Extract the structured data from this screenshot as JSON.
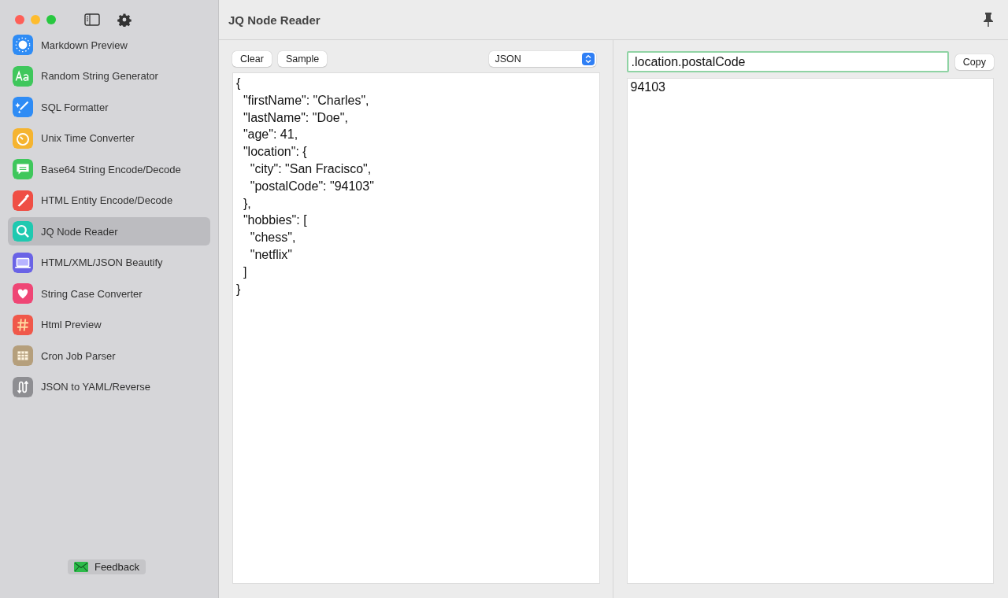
{
  "sidebar": {
    "items": [
      {
        "label": "Markdown Preview",
        "color": "#2f8cf5",
        "selected": false
      },
      {
        "label": "Random String Generator",
        "color": "#3fc75c",
        "selected": false
      },
      {
        "label": "SQL Formatter",
        "color": "#2f8cf5",
        "selected": false
      },
      {
        "label": "Unix Time Converter",
        "color": "#f5b430",
        "selected": false
      },
      {
        "label": "Base64 String Encode/Decode",
        "color": "#3fc75c",
        "selected": false
      },
      {
        "label": "HTML Entity Encode/Decode",
        "color": "#ef4f45",
        "selected": false
      },
      {
        "label": "JQ Node Reader",
        "color": "#1fc9b0",
        "selected": true
      },
      {
        "label": "HTML/XML/JSON Beautify",
        "color": "#6a63e6",
        "selected": false
      },
      {
        "label": "String Case Converter",
        "color": "#ef4675",
        "selected": false
      },
      {
        "label": "Html Preview",
        "color": "#f0584a",
        "selected": false
      },
      {
        "label": "Cron Job Parser",
        "color": "#b59f7c",
        "selected": false
      },
      {
        "label": "JSON to YAML/Reverse",
        "color": "#8e8e92",
        "selected": false
      }
    ],
    "feedback": "Feedback"
  },
  "window": {
    "title": "JQ Node Reader"
  },
  "input_pane": {
    "buttons": [
      "Clear",
      "Sample"
    ],
    "format": "JSON",
    "lines": [
      "{",
      "  \"firstName\": \"Charles\",",
      "  \"lastName\": \"Doe\",",
      "  \"age\": 41,",
      "  \"location\": {",
      "    \"city\": \"San Fracisco\",",
      "    \"postalCode\": \"94103\"",
      "  },",
      "  \"hobbies\": [",
      "    \"chess\",",
      "    \"netflix\"",
      "  ]",
      "}"
    ]
  },
  "output_pane": {
    "query": ".location.postalCode",
    "copy_button": "Copy",
    "result": "94103"
  }
}
